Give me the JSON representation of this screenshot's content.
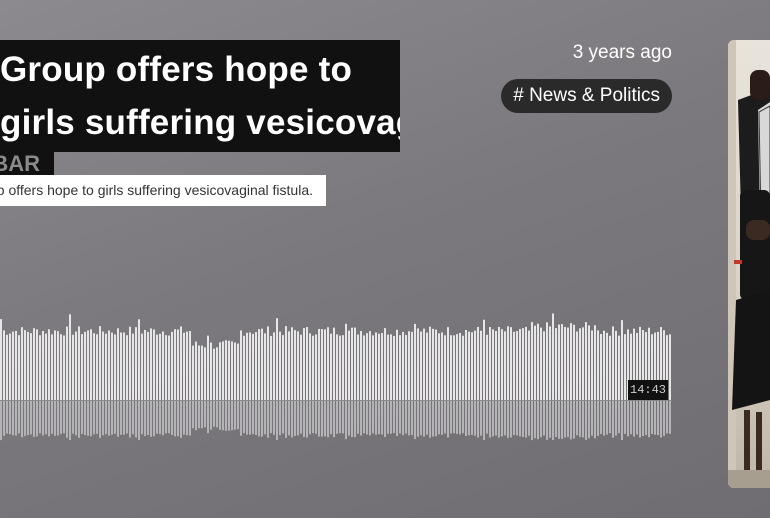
{
  "track": {
    "title_line1": "Group offers hope to",
    "title_line2": "girls suffering vesicovaginal fistula.",
    "artist": "KILIMANJARO BAR",
    "description": "Group offers hope to girls suffering vesicovaginal fistula.",
    "posted": "3 years ago",
    "tag": "# News & Politics",
    "duration": "14:43"
  },
  "colors": {
    "title_bg": "#111111",
    "tag_bg": "#2a2a2a",
    "waveform_upper": "#e6e6e6",
    "waveform_lower": "#b4b4b6"
  },
  "icons": {
    "artwork": "track-artwork-image"
  }
}
